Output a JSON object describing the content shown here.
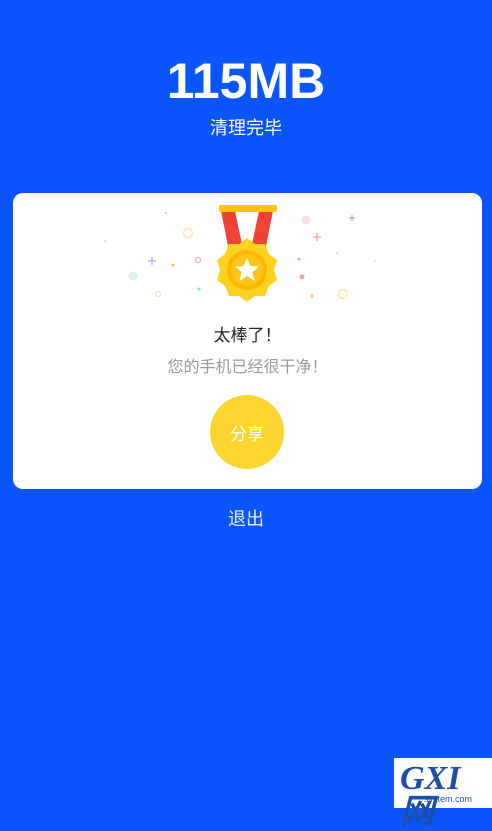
{
  "header": {
    "size": "115MB",
    "status": "清理完毕"
  },
  "result_card": {
    "title": "太棒了！",
    "message": "您的手机已经很干净！",
    "share_label": "分享"
  },
  "exit_label": "退出",
  "watermark": {
    "main": "GXI网",
    "sub": "system.com"
  },
  "colors": {
    "background": "#0A55FB",
    "card": "#FFFFFF",
    "share_button": "#FDD52F",
    "medal_ribbon_red": "#F04336",
    "medal_gold": "#FFC20E"
  }
}
